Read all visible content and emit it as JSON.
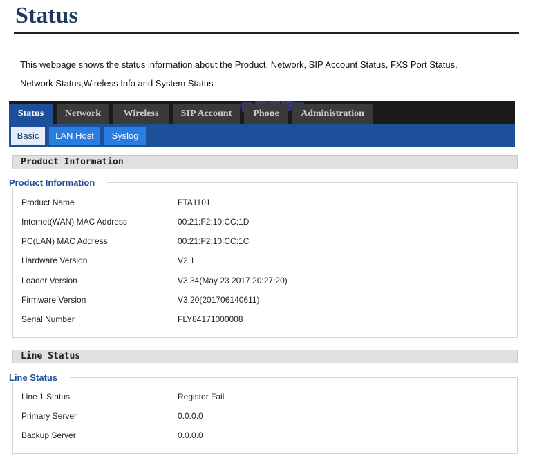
{
  "page": {
    "title": "Status",
    "intro_line1": "This webpage shows the status information about the Product, Network,  SIP Account Status, FXS Port Status,",
    "intro_line2": "Network Status,Wireless Info and System Status"
  },
  "nav": {
    "main_tabs": [
      "Status",
      "Network",
      "Wireless",
      "SIP Account",
      "Phone",
      "Administration"
    ],
    "active_main": "Status",
    "sub_tabs": [
      "Basic",
      "LAN Host",
      "Syslog"
    ],
    "active_sub": "Basic"
  },
  "product": {
    "section_title": "Product Information",
    "group_title": "Product Information",
    "rows": [
      {
        "label": "Product Name",
        "value": "FTA1101"
      },
      {
        "label": "Internet(WAN) MAC Address",
        "value": "00:21:F2:10:CC:1D"
      },
      {
        "label": "PC(LAN) MAC Address",
        "value": "00:21:F2:10:CC:1C"
      },
      {
        "label": "Hardware Version",
        "value": "V2.1"
      },
      {
        "label": "Loader Version",
        "value": "V3.34(May 23 2017 20:27:20)"
      },
      {
        "label": "Firmware Version",
        "value": "V3.20(201706140611)"
      },
      {
        "label": "Serial Number",
        "value": "FLY84171000008"
      }
    ]
  },
  "line": {
    "section_title": "Line Status",
    "group_title": "Line Status",
    "rows": [
      {
        "label": "Line 1 Status",
        "value": "Register Fail"
      },
      {
        "label": "Primary Server",
        "value": "0.0.0.0"
      },
      {
        "label": "Backup Server",
        "value": "0.0.0.0"
      }
    ]
  }
}
